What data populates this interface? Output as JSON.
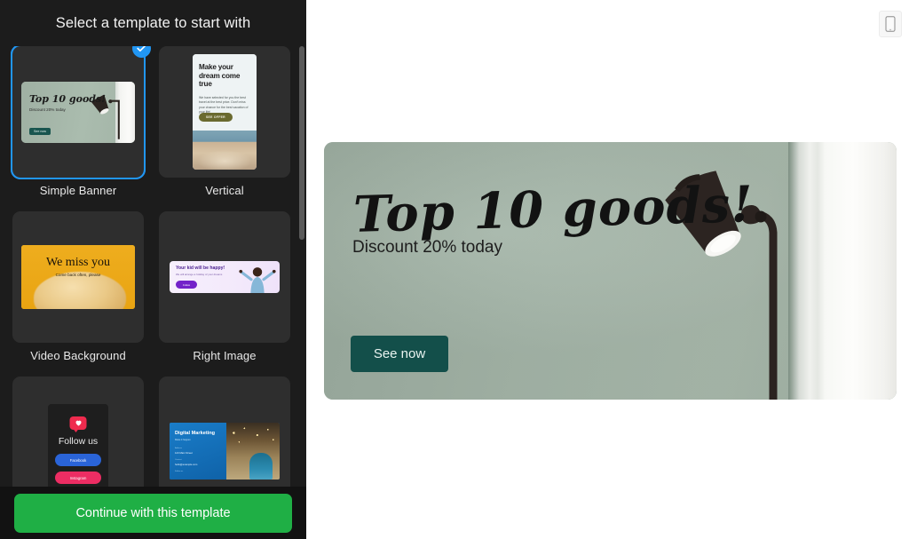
{
  "sidebar": {
    "title": "Select a template to start with",
    "templates": [
      {
        "label": "Simple Banner",
        "selected": true,
        "check_icon": "check-icon",
        "preview": {
          "kind": "banner",
          "headline": "Top 10 goods!",
          "subhead": "Discount 20% today",
          "button": "See now"
        }
      },
      {
        "label": "Vertical",
        "selected": false,
        "preview": {
          "kind": "vertical",
          "headline": "Make your dream come true",
          "body": "We have selected for you the best travel at the best price. Don't miss your chance for the best vacation of your life!",
          "button": "SEE OFFER"
        }
      },
      {
        "label": "Video Background",
        "selected": false,
        "preview": {
          "kind": "video",
          "headline": "We miss you",
          "subhead": "Come back often, please"
        }
      },
      {
        "label": "Right Image",
        "selected": false,
        "preview": {
          "kind": "right-image",
          "headline": "Your kid will be happy!",
          "body": "We will arrange a holiday of your dreams",
          "button": "Follow"
        }
      },
      {
        "label": "",
        "selected": false,
        "preview": {
          "kind": "follow",
          "headline": "Follow us",
          "icon": "heart-notification-icon",
          "button_1": "Facebook",
          "button_2": "Instagram"
        }
      },
      {
        "label": "",
        "selected": false,
        "preview": {
          "kind": "digital-marketing",
          "headline": "Digital Marketing",
          "subhead": "Make it happen",
          "row_1_label": "Address",
          "row_1_value": "123 Main Street",
          "row_2_label": "Contact",
          "row_2_value": "hello@example.com",
          "row_3_label": "Follow us"
        }
      }
    ],
    "footer": {
      "continue_label": "Continue with this template"
    },
    "scrollbar": {
      "name": "template-list-scrollbar"
    }
  },
  "canvas": {
    "device_toggle_icon": "mobile-device-icon",
    "banner": {
      "headline": "Top 10 goods!",
      "subhead": "Discount 20% today",
      "button": "See now",
      "lamp_icon": "desk-lamp-image"
    }
  },
  "colors": {
    "sidebar_bg": "#1c1c1c",
    "card_bg": "#2e2e2e",
    "selection_blue": "#2196f3",
    "continue_green": "#1faf45",
    "banner_wall": "#a8b8ac",
    "banner_button": "#134f4a",
    "canvas_bg": "#ffffff"
  }
}
